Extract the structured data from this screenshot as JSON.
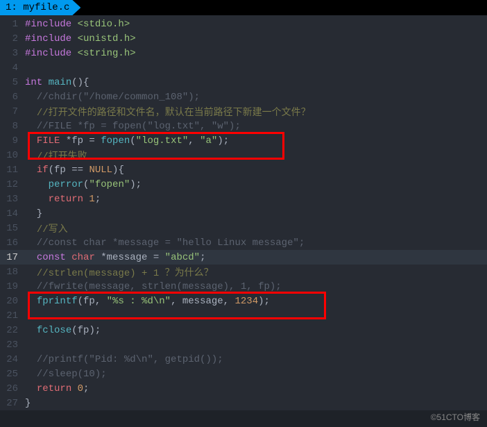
{
  "tab": {
    "label": "1: myfile.c"
  },
  "lines": [
    {
      "n": "1",
      "tokens": [
        [
          "tok-pre",
          "#include "
        ],
        [
          "tok-inc",
          "<stdio.h>"
        ]
      ]
    },
    {
      "n": "2",
      "tokens": [
        [
          "tok-pre",
          "#include "
        ],
        [
          "tok-inc",
          "<unistd.h>"
        ]
      ]
    },
    {
      "n": "3",
      "tokens": [
        [
          "tok-pre",
          "#include "
        ],
        [
          "tok-inc",
          "<string.h>"
        ]
      ]
    },
    {
      "n": "4",
      "tokens": []
    },
    {
      "n": "5",
      "tokens": [
        [
          "tok-type",
          "int "
        ],
        [
          "tok-func",
          "main"
        ],
        [
          "tok-op",
          "(){"
        ]
      ]
    },
    {
      "n": "6",
      "tokens": [
        [
          "tok-op",
          "  "
        ],
        [
          "tok-cmt",
          "//chdir(\"/home/common_108\");"
        ]
      ]
    },
    {
      "n": "7",
      "tokens": [
        [
          "tok-op",
          "  "
        ],
        [
          "tok-cmt-zh",
          "//打开文件的路径和文件名，默认在当前路径下新建一个文件？"
        ]
      ]
    },
    {
      "n": "8",
      "tokens": [
        [
          "tok-op",
          "  "
        ],
        [
          "tok-cmt",
          "//FILE *fp = fopen(\"log.txt\", \"w\");"
        ]
      ]
    },
    {
      "n": "9",
      "tokens": [
        [
          "tok-op",
          "  "
        ],
        [
          "tok-kw",
          "FILE "
        ],
        [
          "tok-op",
          "*fp = "
        ],
        [
          "tok-func",
          "fopen"
        ],
        [
          "tok-op",
          "("
        ],
        [
          "tok-str",
          "\"log.txt\""
        ],
        [
          "tok-op",
          ", "
        ],
        [
          "tok-str",
          "\"a\""
        ],
        [
          "tok-op",
          ");"
        ]
      ]
    },
    {
      "n": "10",
      "tokens": [
        [
          "tok-op",
          "  "
        ],
        [
          "tok-cmt-zh",
          "//打开失败"
        ]
      ]
    },
    {
      "n": "11",
      "tokens": [
        [
          "tok-op",
          "  "
        ],
        [
          "tok-kw",
          "if"
        ],
        [
          "tok-op",
          "(fp == "
        ],
        [
          "tok-num",
          "NULL"
        ],
        [
          "tok-op",
          "){"
        ]
      ]
    },
    {
      "n": "12",
      "tokens": [
        [
          "tok-op",
          "    "
        ],
        [
          "tok-func",
          "perror"
        ],
        [
          "tok-op",
          "("
        ],
        [
          "tok-str",
          "\"fopen\""
        ],
        [
          "tok-op",
          ");"
        ]
      ]
    },
    {
      "n": "13",
      "tokens": [
        [
          "tok-op",
          "    "
        ],
        [
          "tok-kw",
          "return "
        ],
        [
          "tok-num",
          "1"
        ],
        [
          "tok-op",
          ";"
        ]
      ]
    },
    {
      "n": "14",
      "tokens": [
        [
          "tok-op",
          "  }"
        ]
      ]
    },
    {
      "n": "15",
      "tokens": [
        [
          "tok-op",
          "  "
        ],
        [
          "tok-cmt-zh",
          "//写入"
        ]
      ]
    },
    {
      "n": "16",
      "tokens": [
        [
          "tok-op",
          "  "
        ],
        [
          "tok-cmt",
          "//const char *message = \"hello Linux message\";"
        ]
      ]
    },
    {
      "n": "17",
      "hl": true,
      "tokens": [
        [
          "tok-op",
          "  "
        ],
        [
          "tok-type",
          "const "
        ],
        [
          "tok-kw",
          "char "
        ],
        [
          "tok-op",
          "*message = "
        ],
        [
          "tok-str",
          "\"abcd\""
        ],
        [
          "tok-op",
          ";"
        ]
      ]
    },
    {
      "n": "18",
      "tokens": [
        [
          "tok-op",
          "  "
        ],
        [
          "tok-cmt-zh",
          "//strlen(message) + 1 ？为什么？"
        ]
      ]
    },
    {
      "n": "19",
      "tokens": [
        [
          "tok-op",
          "  "
        ],
        [
          "tok-cmt",
          "//fwrite(message, strlen(message), 1, fp);"
        ]
      ]
    },
    {
      "n": "20",
      "tokens": [
        [
          "tok-op",
          "  "
        ],
        [
          "tok-func",
          "fprintf"
        ],
        [
          "tok-op",
          "(fp, "
        ],
        [
          "tok-str",
          "\"%s : %d\\n\""
        ],
        [
          "tok-op",
          ", message, "
        ],
        [
          "tok-num",
          "1234"
        ],
        [
          "tok-op",
          ");"
        ]
      ]
    },
    {
      "n": "21",
      "tokens": []
    },
    {
      "n": "22",
      "tokens": [
        [
          "tok-op",
          "  "
        ],
        [
          "tok-func",
          "fclose"
        ],
        [
          "tok-op",
          "(fp);"
        ]
      ]
    },
    {
      "n": "23",
      "tokens": []
    },
    {
      "n": "24",
      "tokens": [
        [
          "tok-op",
          "  "
        ],
        [
          "tok-cmt",
          "//printf(\"Pid: %d\\n\", getpid());"
        ]
      ]
    },
    {
      "n": "25",
      "tokens": [
        [
          "tok-op",
          "  "
        ],
        [
          "tok-cmt",
          "//sleep(10);"
        ]
      ]
    },
    {
      "n": "26",
      "tokens": [
        [
          "tok-op",
          "  "
        ],
        [
          "tok-kw",
          "return "
        ],
        [
          "tok-num",
          "0"
        ],
        [
          "tok-op",
          ";"
        ]
      ]
    },
    {
      "n": "27",
      "tokens": [
        [
          "tok-op",
          "}"
        ]
      ]
    }
  ],
  "watermark": "©51CTO博客"
}
